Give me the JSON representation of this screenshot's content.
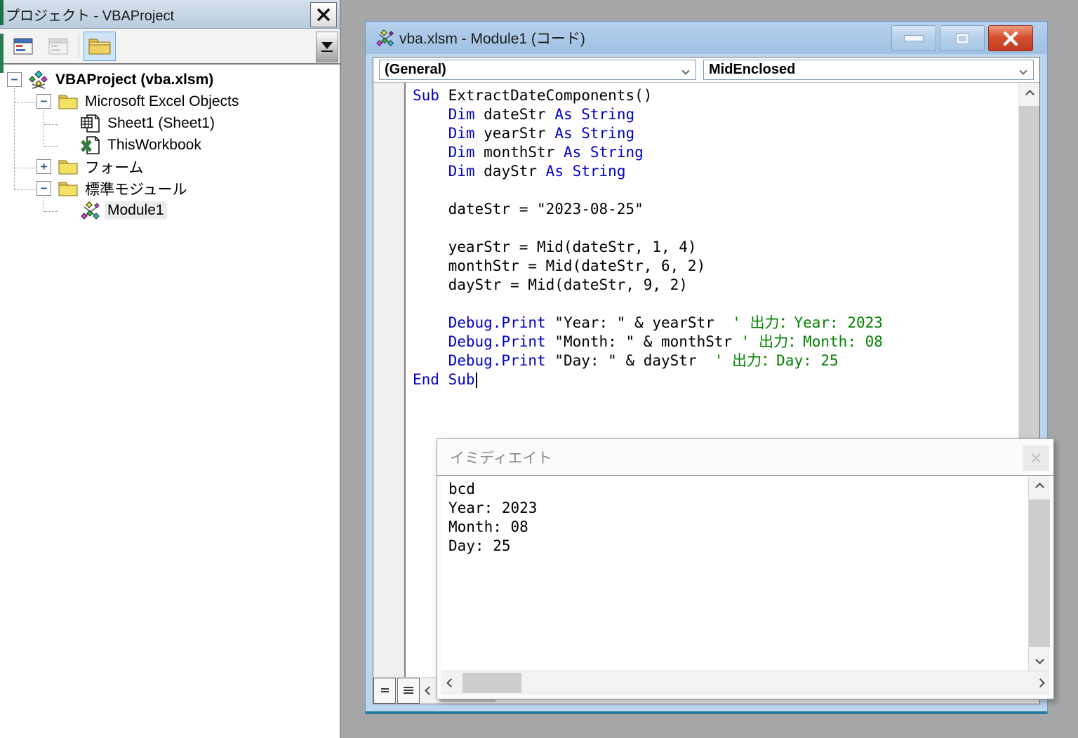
{
  "colors": {
    "keyword": "#0000C8",
    "identifier": "#000000",
    "comment": "#008000",
    "titlebar_blue": "#A9C6E8",
    "close_red": "#C0392B",
    "mdi_gray": "#A6A6A6"
  },
  "glyphs": {
    "minus": "−",
    "plus": "+"
  },
  "project_panel": {
    "title": "プロジェクト - VBAProject",
    "tree": {
      "items": [
        {
          "label": "VBAProject (vba.xlsm)"
        },
        {
          "label": "Microsoft Excel Objects"
        },
        {
          "label": "Sheet1 (Sheet1)"
        },
        {
          "label": "ThisWorkbook"
        },
        {
          "label": "フォーム"
        },
        {
          "label": "標準モジュール"
        },
        {
          "label": "Module1"
        }
      ]
    }
  },
  "code_window": {
    "title": "vba.xlsm - Module1 (コード)",
    "left_dropdown": "(General)",
    "right_dropdown": "MidEnclosed",
    "code_lines": [
      {
        "segs": [
          {
            "t": "Sub ",
            "c": "kw"
          },
          {
            "t": "ExtractDateComponents()",
            "c": "id"
          }
        ]
      },
      {
        "segs": [
          {
            "t": "    ",
            "c": "id"
          },
          {
            "t": "Dim",
            "c": "kw"
          },
          {
            "t": " dateStr ",
            "c": "id"
          },
          {
            "t": "As String",
            "c": "kw"
          }
        ]
      },
      {
        "segs": [
          {
            "t": "    ",
            "c": "id"
          },
          {
            "t": "Dim",
            "c": "kw"
          },
          {
            "t": " yearStr ",
            "c": "id"
          },
          {
            "t": "As String",
            "c": "kw"
          }
        ]
      },
      {
        "segs": [
          {
            "t": "    ",
            "c": "id"
          },
          {
            "t": "Dim",
            "c": "kw"
          },
          {
            "t": " monthStr ",
            "c": "id"
          },
          {
            "t": "As String",
            "c": "kw"
          }
        ]
      },
      {
        "segs": [
          {
            "t": "    ",
            "c": "id"
          },
          {
            "t": "Dim",
            "c": "kw"
          },
          {
            "t": " dayStr ",
            "c": "id"
          },
          {
            "t": "As String",
            "c": "kw"
          }
        ]
      },
      {
        "segs": []
      },
      {
        "segs": [
          {
            "t": "    dateStr = \"2023-08-25\"",
            "c": "id"
          }
        ]
      },
      {
        "segs": []
      },
      {
        "segs": [
          {
            "t": "    yearStr = Mid(dateStr, 1, 4)",
            "c": "id"
          }
        ]
      },
      {
        "segs": [
          {
            "t": "    monthStr = Mid(dateStr, 6, 2)",
            "c": "id"
          }
        ]
      },
      {
        "segs": [
          {
            "t": "    dayStr = Mid(dateStr, 9, 2)",
            "c": "id"
          }
        ]
      },
      {
        "segs": []
      },
      {
        "segs": [
          {
            "t": "    ",
            "c": "id"
          },
          {
            "t": "Debug.Print",
            "c": "kw"
          },
          {
            "t": " \"Year: \" & yearStr  ",
            "c": "id"
          },
          {
            "t": "' 出力：Year: 2023",
            "c": "cm"
          }
        ]
      },
      {
        "segs": [
          {
            "t": "    ",
            "c": "id"
          },
          {
            "t": "Debug.Print",
            "c": "kw"
          },
          {
            "t": " \"Month: \" & monthStr ",
            "c": "id"
          },
          {
            "t": "' 出力：Month: 08",
            "c": "cm"
          }
        ]
      },
      {
        "segs": [
          {
            "t": "    ",
            "c": "id"
          },
          {
            "t": "Debug.Print",
            "c": "kw"
          },
          {
            "t": " \"Day: \" & dayStr  ",
            "c": "id"
          },
          {
            "t": "' 出力：Day: 25",
            "c": "cm"
          }
        ]
      },
      {
        "segs": [
          {
            "t": "End Sub",
            "c": "kw"
          }
        ],
        "caret": true
      }
    ]
  },
  "immediate_window": {
    "title": "イミディエイト",
    "lines": [
      "bcd",
      "Year: 2023",
      "Month: 08",
      "Day: 25"
    ]
  }
}
